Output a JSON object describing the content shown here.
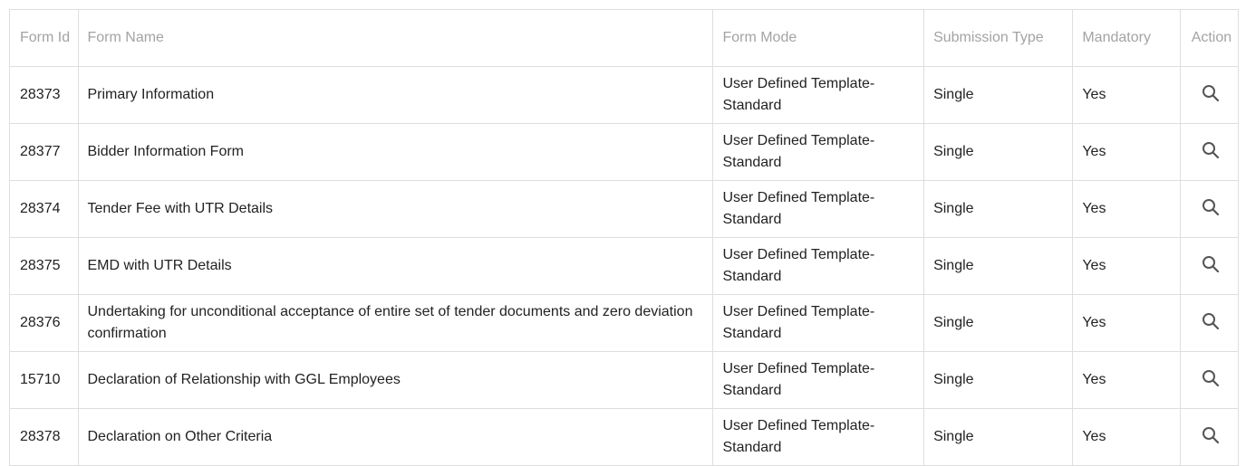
{
  "table": {
    "columns": {
      "form_id": "Form Id",
      "form_name": "Form Name",
      "form_mode": "Form Mode",
      "submission_type": "Submission Type",
      "mandatory": "Mandatory",
      "action": "Action"
    },
    "rows": [
      {
        "form_id": "28373",
        "form_name": "Primary Information",
        "form_mode": "User Defined Template-Standard",
        "submission_type": "Single",
        "mandatory": "Yes",
        "action_icon": "search-icon"
      },
      {
        "form_id": "28377",
        "form_name": "Bidder Information Form",
        "form_mode": "User Defined Template-Standard",
        "submission_type": "Single",
        "mandatory": "Yes",
        "action_icon": "search-icon"
      },
      {
        "form_id": "28374",
        "form_name": "Tender Fee with UTR Details",
        "form_mode": "User Defined Template-Standard",
        "submission_type": "Single",
        "mandatory": "Yes",
        "action_icon": "search-icon"
      },
      {
        "form_id": "28375",
        "form_name": "EMD with UTR Details",
        "form_mode": "User Defined Template-Standard",
        "submission_type": "Single",
        "mandatory": "Yes",
        "action_icon": "search-icon"
      },
      {
        "form_id": "28376",
        "form_name": "Undertaking for unconditional acceptance of entire set of tender documents and zero deviation confirmation",
        "form_mode": "User Defined Template-Standard",
        "submission_type": "Single",
        "mandatory": "Yes",
        "action_icon": "search-icon"
      },
      {
        "form_id": "15710",
        "form_name": "Declaration of Relationship with GGL Employees",
        "form_mode": "User Defined Template-Standard",
        "submission_type": "Single",
        "mandatory": "Yes",
        "action_icon": "search-icon"
      },
      {
        "form_id": "28378",
        "form_name": "Declaration on Other Criteria",
        "form_mode": "User Defined Template-Standard",
        "submission_type": "Single",
        "mandatory": "Yes",
        "action_icon": "search-icon"
      }
    ]
  },
  "colors": {
    "header_text": "#a3a3a3",
    "body_text": "#222222",
    "border": "#dedede",
    "icon": "#555555"
  }
}
